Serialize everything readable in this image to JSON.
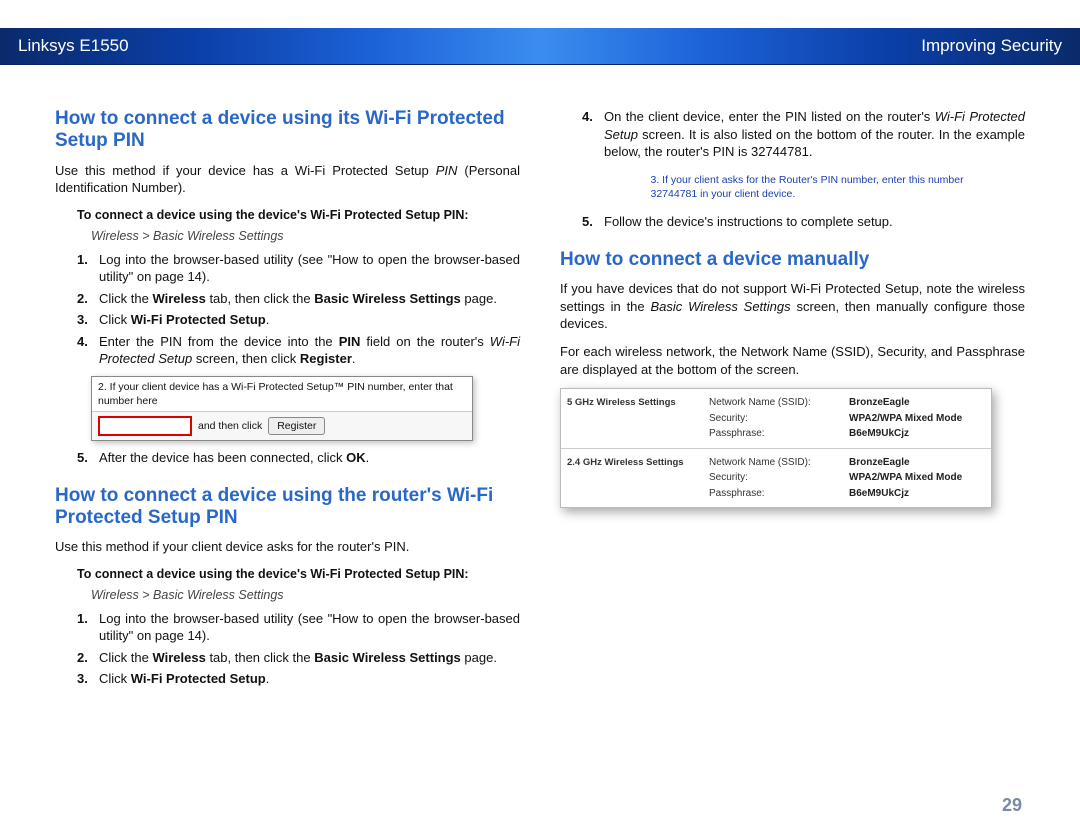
{
  "header": {
    "left": "Linksys E1550",
    "right": "Improving Security"
  },
  "page_number": "29",
  "sectionA": {
    "title": "How to connect a device using its Wi-Fi Protected Setup PIN",
    "intro_pre": "Use this method if your device has a Wi-Fi Protected Setup ",
    "intro_pin": "PIN",
    "intro_post": " (Personal Identification Number).",
    "subhead": "To connect a device using the device's Wi-Fi Protected Setup PIN:",
    "breadcrumb": "Wireless > Basic Wireless Settings",
    "step1": "Log into the browser-based utility (see \"How to open the browser-based utility\" on page 14).",
    "step2_pre": "Click the ",
    "step2_b1": "Wireless",
    "step2_mid": " tab, then click the ",
    "step2_b2": "Basic Wireless Settings",
    "step2_post": " page.",
    "step3_pre": "Click ",
    "step3_b": "Wi-Fi Protected Setup",
    "step3_post": ".",
    "step4_pre": "Enter the PIN from the device into the ",
    "step4_b1": "PIN",
    "step4_mid": " field on the router's ",
    "step4_i": "Wi-Fi Protected Setup",
    "step4_mid2": " screen, then click ",
    "step4_b2": "Register",
    "step4_post": ".",
    "wps_note": "2. If your client device has a Wi-Fi Protected Setup™ PIN number, enter that number here",
    "wps_andthen": "and then click",
    "wps_btn": "Register",
    "step5_pre": "After the device has been connected, click ",
    "step5_b": "OK",
    "step5_post": "."
  },
  "sectionB": {
    "title": "How to connect a device using the router's Wi-Fi Protected Setup PIN",
    "intro": "Use this method if your client device asks for the router's PIN.",
    "subhead": "To connect a device using the device's Wi-Fi Protected Setup PIN:",
    "breadcrumb": "Wireless > Basic Wireless Settings",
    "step1": "Log into the browser-based utility (see \"How to open the browser-based utility\" on page 14).",
    "step2_pre": "Click the ",
    "step2_b1": "Wireless",
    "step2_mid": " tab, then click the ",
    "step2_b2": "Basic Wireless Settings",
    "step2_post": " page.",
    "step3_pre": "Click ",
    "step3_b": "Wi-Fi Protected Setup",
    "step3_post": "."
  },
  "sectionB2": {
    "step4_pre": "On the client device, enter the PIN listed on the router's ",
    "step4_i": "Wi-Fi Protected Setup",
    "step4_post": " screen. It is also listed on the bottom of the router. In the example below, the router's PIN is 32744781.",
    "routerpin_text": "3. If your client asks for the Router's PIN number, enter this number 32744781 in your client device.",
    "step5": "Follow the device's instructions to complete setup."
  },
  "sectionC": {
    "title": "How to connect a device manually",
    "p1_pre": "If you have devices that do not support Wi-Fi Protected Setup, note the wireless settings in the ",
    "p1_i": "Basic Wireless Settings",
    "p1_post": " screen, then manually configure those devices.",
    "p2": "For each wireless network, the Network Name (SSID), Security, and Passphrase are displayed at the bottom of the screen.",
    "band5": "5 GHz Wireless Settings",
    "band24": "2.4 GHz Wireless Settings",
    "lab_ssid": "Network Name (SSID):",
    "lab_sec": "Security:",
    "lab_pass": "Passphrase:",
    "val_ssid": "BronzeEagle",
    "val_sec": "WPA2/WPA Mixed Mode",
    "val_pass": "B6eM9UkCjz"
  }
}
